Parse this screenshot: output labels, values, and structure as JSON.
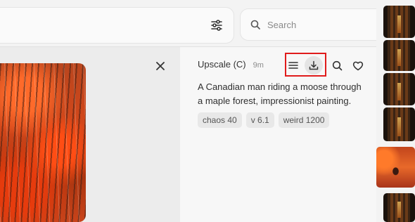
{
  "toolbar": {
    "filter_icon": "sliders-icon",
    "search": {
      "placeholder": "Search",
      "value": "",
      "icon": "search-icon"
    }
  },
  "viewer": {
    "image_alt": "Canadian man riding a moose through a maple forest",
    "close_icon": "close-icon"
  },
  "details": {
    "title": "Upscale (C)",
    "age": "9m",
    "actions": [
      {
        "name": "menu",
        "icon": "hamburger-icon"
      },
      {
        "name": "download",
        "icon": "download-icon",
        "highlighted": true
      },
      {
        "name": "search",
        "icon": "search-icon"
      },
      {
        "name": "like",
        "icon": "heart-icon"
      }
    ],
    "prompt": "A Canadian man riding a moose through a maple forest, impressionist painting.",
    "params": [
      "chaos 40",
      "v 6.1",
      "weird 1200"
    ]
  },
  "colors": {
    "highlight": "#e01b1b",
    "chip_bg": "#e8e8e8",
    "panel_bg": "#f7f7f7"
  }
}
